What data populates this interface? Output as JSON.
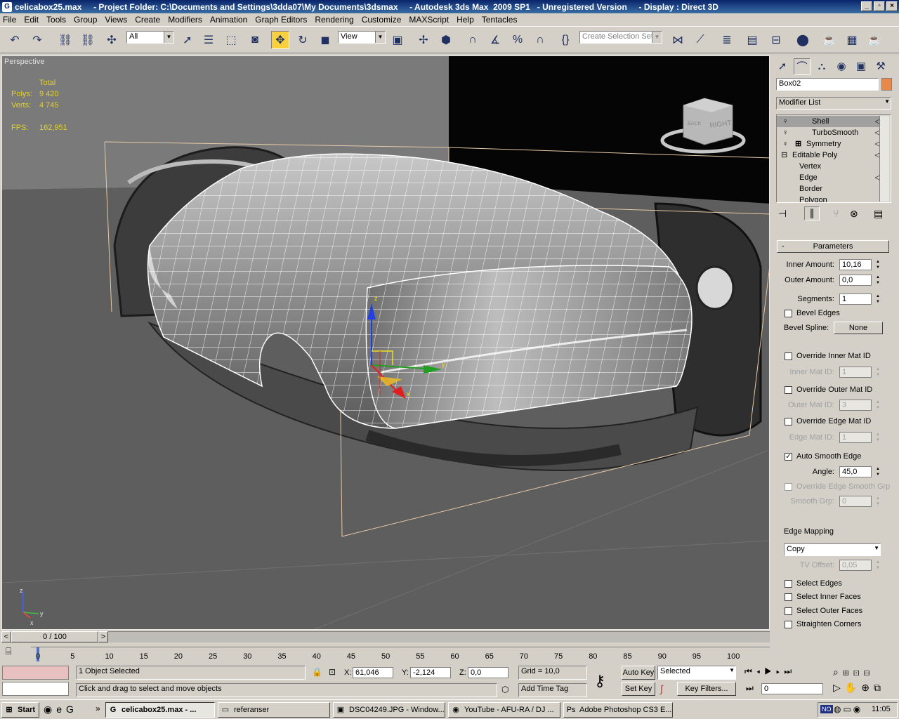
{
  "window": {
    "title": "celicabox25.max     - Project Folder: C:\\Documents and Settings\\3dda07\\My Documents\\3dsmax     - Autodesk 3ds Max  2009 SP1   - Unregistered Version     - Display : Direct 3D",
    "min_label": "_",
    "max_label": "▫",
    "close_label": "×"
  },
  "menu": [
    "File",
    "Edit",
    "Tools",
    "Group",
    "Views",
    "Create",
    "Modifiers",
    "Animation",
    "Graph Editors",
    "Rendering",
    "Customize",
    "MAXScript",
    "Help",
    "Tentacles"
  ],
  "toolbar": {
    "filter_value": "All",
    "refcoord_value": "View",
    "selection_set_placeholder": "Create Selection Set"
  },
  "viewport": {
    "label": "Perspective",
    "stats": {
      "total_label": "Total",
      "polys_label": "Polys:",
      "polys_value": "9 420",
      "verts_label": "Verts:",
      "verts_value": "4 745",
      "fps_label": "FPS:",
      "fps_value": "162,951"
    },
    "viewcube_label": "RIGHT",
    "viewcube_side": "BACK",
    "gizmo": {
      "x": "x",
      "y": "y",
      "z": "z"
    },
    "axis_tripod": {
      "x": "x",
      "y": "y",
      "z": "z"
    }
  },
  "command_panel": {
    "object_name": "Box02",
    "object_color": "#e8884a",
    "modifier_list_label": "Modifier List",
    "stack": [
      {
        "label": "Shell",
        "selected": true
      },
      {
        "label": "TurboSmooth"
      },
      {
        "label": "Symmetry"
      },
      {
        "label": "Editable Poly"
      },
      {
        "label": "Vertex"
      },
      {
        "label": "Edge"
      },
      {
        "label": "Border"
      },
      {
        "label": "Polygon"
      }
    ],
    "rollout_title": "Parameters",
    "rollout_collapse": "-",
    "params": {
      "inner_amount_label": "Inner Amount:",
      "inner_amount": "10,16",
      "outer_amount_label": "Outer Amount:",
      "outer_amount": "0,0",
      "segments_label": "Segments:",
      "segments": "1",
      "bevel_edges_label": "Bevel Edges",
      "bevel_spline_label": "Bevel Spline:",
      "bevel_spline_value": "None",
      "override_inner_label": "Override Inner Mat ID",
      "inner_mat_label": "Inner Mat ID:",
      "inner_mat": "1",
      "override_outer_label": "Override Outer Mat ID",
      "outer_mat_label": "Outer Mat ID:",
      "outer_mat": "3",
      "override_edge_label": "Override Edge Mat ID",
      "edge_mat_label": "Edge Mat ID:",
      "edge_mat": "1",
      "auto_smooth_label": "Auto Smooth Edge",
      "angle_label": "Angle:",
      "angle": "45,0",
      "override_smooth_label": "Override Edge Smooth Grp",
      "smooth_grp_label": "Smooth Grp:",
      "smooth_grp": "0",
      "edge_mapping_label": "Edge Mapping",
      "edge_mapping_value": "Copy",
      "tv_offset_label": "TV Offset:",
      "tv_offset": "0,05",
      "select_edges_label": "Select Edges",
      "select_inner_label": "Select Inner Faces",
      "select_outer_label": "Select Outer Faces",
      "straighten_label": "Straighten Corners"
    }
  },
  "timeline": {
    "frame_label": "0 / 100",
    "ticks": [
      "0",
      "5",
      "10",
      "15",
      "20",
      "25",
      "30",
      "35",
      "40",
      "45",
      "50",
      "55",
      "60",
      "65",
      "70",
      "75",
      "80",
      "85",
      "90",
      "95",
      "100"
    ]
  },
  "status": {
    "selected_text": "1 Object Selected",
    "prompt_text": "Click and drag to select and move objects",
    "x_label": "X:",
    "x_value": "61,046",
    "y_label": "Y:",
    "y_value": "-2,124",
    "z_label": "Z:",
    "z_value": "0,0",
    "grid_text": "Grid = 10,0",
    "add_time_tag": "Add Time Tag",
    "auto_key": "Auto Key",
    "set_key": "Set Key",
    "selected_dropdown": "Selected",
    "key_filters": "Key Filters...",
    "frame_value": "0"
  },
  "taskbar": {
    "start": "Start",
    "tasks": [
      "celicabox25.max    - ...",
      "referanser",
      "DSC04249.JPG - Window...",
      "YouTube - AFU-RA / DJ ...",
      "Adobe Photoshop CS3 E..."
    ],
    "clock": "11:05",
    "tray_lang": "NO"
  }
}
